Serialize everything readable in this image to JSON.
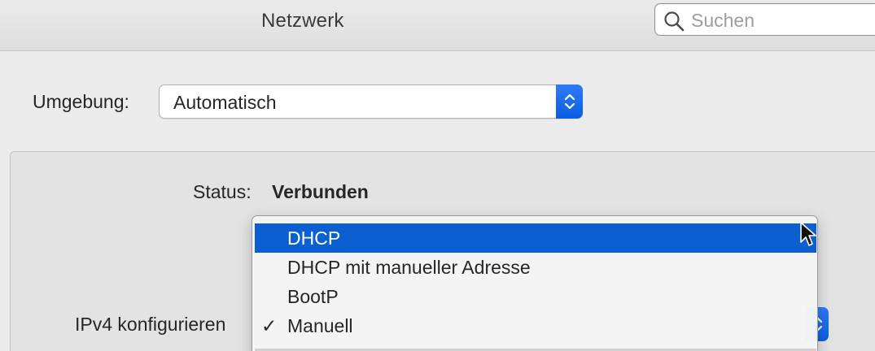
{
  "window": {
    "title": "Netzwerk"
  },
  "search": {
    "placeholder": "Suchen",
    "value": "",
    "icon": "search-icon"
  },
  "location": {
    "label": "Umgebung:",
    "value": "Automatisch"
  },
  "status": {
    "label": "Status:",
    "value": "Verbunden"
  },
  "ipv4": {
    "label": "IPv4 konfigurieren"
  },
  "menu": {
    "items": [
      {
        "label": "DHCP",
        "check": "",
        "highlighted": true
      },
      {
        "label": "DHCP mit manueller Adresse",
        "check": "",
        "highlighted": false
      },
      {
        "label": "BootP",
        "check": "",
        "highlighted": false
      },
      {
        "label": "Manuell",
        "check": "✓",
        "highlighted": false
      }
    ]
  },
  "colors": {
    "accent": "#0c5fd0",
    "window_bg": "#ececec"
  }
}
